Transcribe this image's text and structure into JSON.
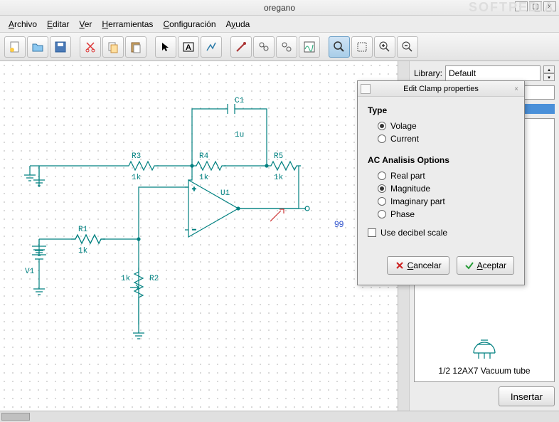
{
  "window": {
    "title": "oregano"
  },
  "menu": {
    "archivo": "Archivo",
    "editar": "Editar",
    "ver": "Ver",
    "herramientas": "Herramientas",
    "configuracion": "Configuración",
    "ayuda": "Ayuda"
  },
  "library": {
    "label": "Library:",
    "selected": "Default"
  },
  "part": {
    "name": "1/2 12AX7 Vacuum tube",
    "insert": "Insertar"
  },
  "dialog": {
    "title": "Edit Clamp properties",
    "type_heading": "Type",
    "opt_voltage": "Volage",
    "opt_current": "Current",
    "ac_heading": "AC Analisis Options",
    "opt_real": "Real part",
    "opt_magnitude": "Magnitude",
    "opt_imaginary": "Imaginary part",
    "opt_phase": "Phase",
    "decibel": "Use decibel scale",
    "cancel": "Cancelar",
    "accept": "Aceptar"
  },
  "schematic": {
    "c1": {
      "name": "C1",
      "value": "1u"
    },
    "r1": {
      "name": "R1",
      "value": "1k"
    },
    "r2": {
      "name": "R2",
      "value": "1k"
    },
    "r3": {
      "name": "R3",
      "value": "1k"
    },
    "r4": {
      "name": "R4",
      "value": "1k"
    },
    "r5": {
      "name": "R5",
      "value": "1k"
    },
    "u1": {
      "name": "U1"
    },
    "v1": {
      "name": "V1"
    },
    "net99": "99"
  },
  "watermark": "SOFTPEDIA"
}
